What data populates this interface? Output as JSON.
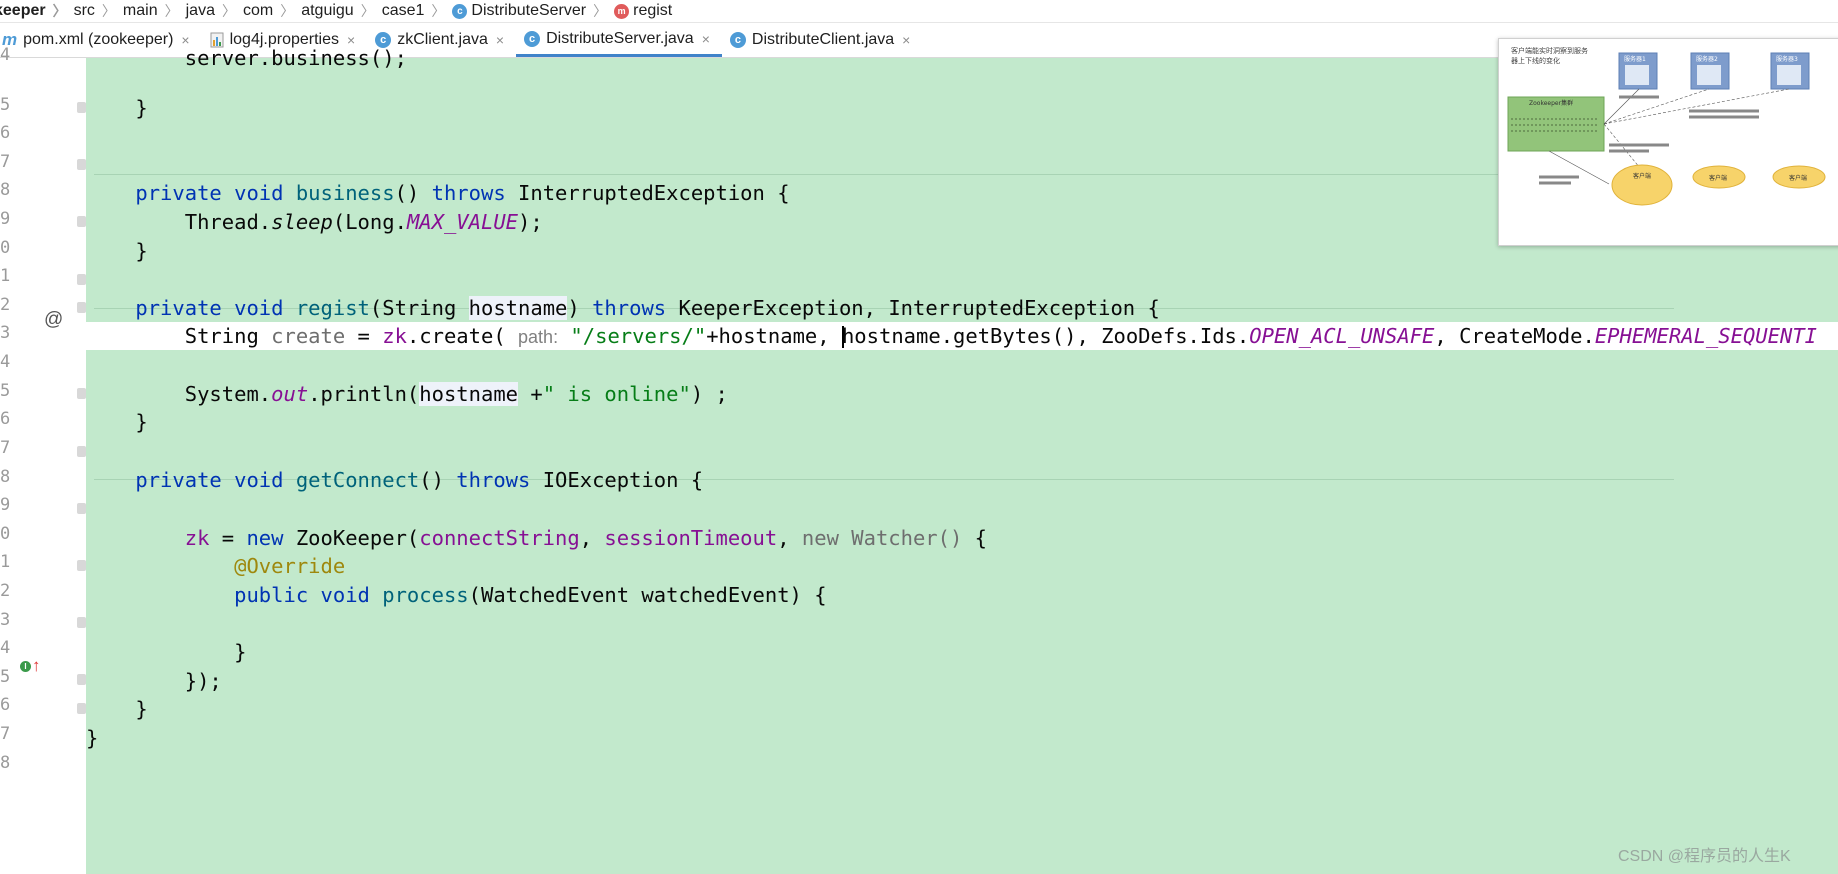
{
  "breadcrumb": [
    "keeper",
    "src",
    "main",
    "java",
    "com",
    "atguigu",
    "case1",
    "DistributeServer",
    "regist"
  ],
  "tabs": [
    {
      "label": "pom.xml (zookeeper)",
      "icon": "maven-icon",
      "close": "×"
    },
    {
      "label": "log4j.properties",
      "icon": "properties-file-icon",
      "close": "×"
    },
    {
      "label": "zkClient.java",
      "icon": "java-class-icon",
      "close": "×"
    },
    {
      "label": "DistributeServer.java",
      "icon": "java-class-icon",
      "close": "×"
    },
    {
      "label": "DistributeClient.java",
      "icon": "java-class-icon",
      "close": "×"
    }
  ],
  "line_numbers": [
    "4",
    "5",
    "6",
    "7",
    "8",
    "9",
    "0",
    "1",
    "2",
    "3",
    "4",
    "5",
    "6",
    "7",
    "8",
    "9",
    "0",
    "1",
    "2",
    "3",
    "4",
    "5",
    "6",
    "7",
    "8"
  ],
  "code": {
    "l4": "server.business();",
    "brace": "}",
    "l8_private": "private",
    "l8_void": "void",
    "l8_name": "business",
    "l8_parens": "() ",
    "l8_throws": "throws",
    "l8_exc": " InterruptedException {",
    "l9_a": "Thread.",
    "l9_sleep": "sleep",
    "l9_b": "(Long.",
    "l9_max": "MAX_VALUE",
    "l9_c": ");",
    "l12_name": "regist",
    "l12_a": "(String ",
    "l12_host": "hostname",
    "l12_b": ") ",
    "l12_exc": " KeeperException, InterruptedException {",
    "l13_a": "String ",
    "l13_create": "create",
    "l13_b": " = ",
    "l13_zk": "zk",
    "l13_c": ".create( ",
    "l13_hint": "path:",
    "l13_str": "\"/servers/\"",
    "l13_d": "+hostname, ",
    "l13_e": "hostname.getBytes(), ZooDefs.Ids.",
    "l13_acl": "OPEN_ACL_UNSAFE",
    "l13_f": ", CreateMode.",
    "l13_mode": "EPHEMERAL_SEQUENTI",
    "l15_a": "System.",
    "l15_out": "out",
    "l15_b": ".println(",
    "l15_host": "hostname",
    "l15_c": " +",
    "l15_str": "\" is online\"",
    "l15_d": ") ;",
    "l18_name": "getConnect",
    "l18_exc": " IOException {",
    "l20_zk": "zk",
    "l20_a": " = ",
    "l20_new": "new",
    "l20_b": " ZooKeeper(",
    "l20_cs": "connectString",
    "l20_c": ", ",
    "l20_st": "sessionTimeout",
    "l20_d": ", ",
    "l20_new2": "new Watcher()",
    "l20_e": " {",
    "l21_ann": "@Override",
    "l22_public": "public",
    "l22_void": "void",
    "l22_name": "process",
    "l22_a": "(WatchedEvent watchedEvent) {",
    "l25": "});"
  },
  "gutter_icons": {
    "line12": "@",
    "line22": "implements-method-icon"
  },
  "thumbnail": {
    "title_line1": "客户端能实时洞察到服务",
    "title_line2": "器上下线的变化",
    "box_label": "Zookeeper集群",
    "servers": [
      "服务器1",
      "服务器2",
      "服务器3"
    ],
    "clients": [
      "客户端",
      "客户端",
      "客户端"
    ]
  },
  "watermark": "CSDN @程序员的人生K",
  "colors": {
    "editor_bg": "#c2e9cc",
    "keyword": "#0033b3",
    "string": "#067d17",
    "field": "#871094",
    "method": "#00627a",
    "annotation": "#9e880d"
  }
}
